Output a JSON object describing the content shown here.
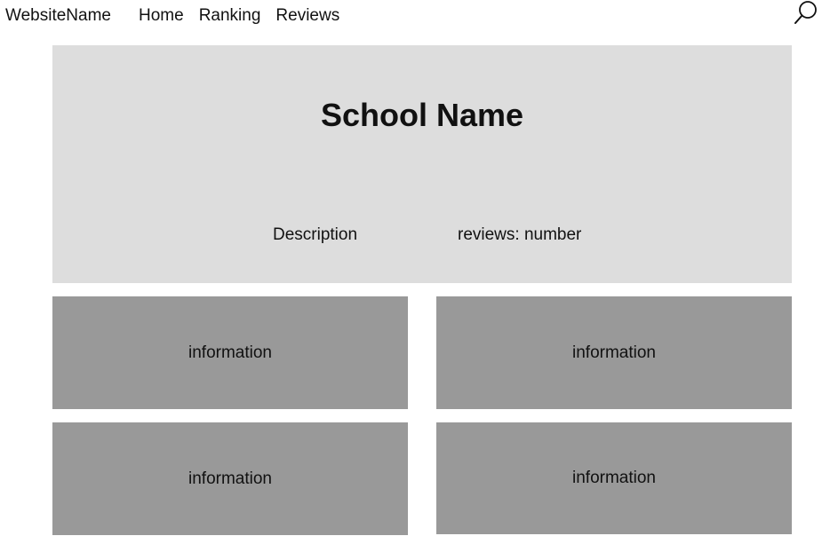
{
  "header": {
    "site_name": "WebsiteName",
    "nav": [
      "Home",
      "Ranking",
      "Reviews"
    ],
    "search_icon": "search-icon"
  },
  "hero": {
    "title": "School Name",
    "description": "Description",
    "reviews": "reviews: number"
  },
  "cards": [
    "information",
    "information",
    "information",
    "information"
  ],
  "colors": {
    "background": "#ffffff",
    "hero_background": "#dddddd",
    "card_background": "#999999",
    "text": "#111111"
  }
}
